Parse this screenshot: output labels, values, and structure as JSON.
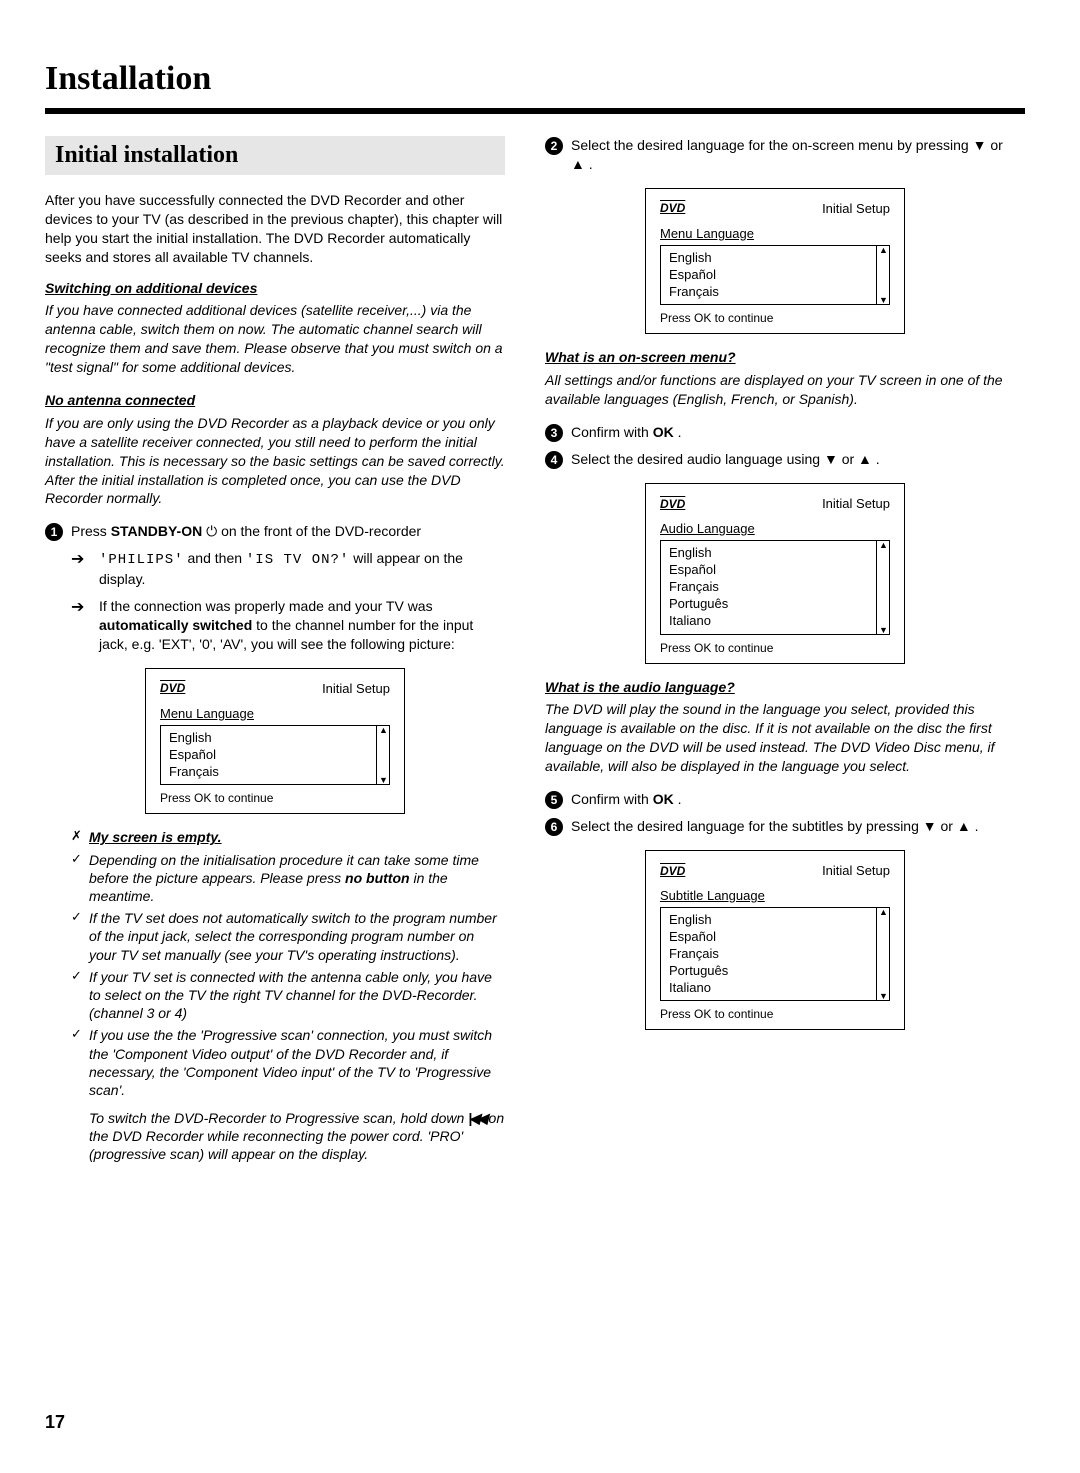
{
  "title": "Installation",
  "section": "Initial installation",
  "intro": "After you have successfully connected the DVD Recorder and other devices to your TV (as described in the previous chapter), this chapter will help you start the initial installation. The DVD Recorder automatically seeks and stores all available TV channels.",
  "sub1_title": "Switching on additional devices",
  "sub1_body": "If you have connected additional devices (satellite receiver,...) via the antenna cable, switch them on now. The automatic channel search will recognize them and save them. Please observe that you must switch on a \"test signal\" for some additional devices.",
  "sub2_title": "No antenna connected",
  "sub2_body": "If you are only using the DVD Recorder as a playback device or you only have a satellite receiver connected, you still need to perform the initial installation. This is necessary so the basic settings can be saved correctly. After the initial installation is completed once, you can use the DVD Recorder normally.",
  "step1_pre": "Press ",
  "step1_bold": "STANDBY-ON",
  "step1_post": " on the front of the DVD-recorder",
  "step1_sub_a": "'PHILIPS'",
  "step1_sub_mid": " and then ",
  "step1_sub_b": "'IS TV ON?'",
  "step1_sub_end": " will appear on the display.",
  "step1_sub2_pre": "If the connection was properly made and your TV was ",
  "step1_sub2_bold": "automatically switched",
  "step1_sub2_post": " to the channel number for the input jack, e.g. 'EXT', '0', 'AV', you will see the following picture:",
  "tv": {
    "logo": "DVD",
    "setup": "Initial Setup",
    "menu_lang": "Menu Language",
    "audio_lang": "Audio Language",
    "sub_lang": "Subtitle Language",
    "ok": "Press OK to continue",
    "langs3": [
      "English",
      "Español",
      "Français"
    ],
    "langs5": [
      "English",
      "Español",
      "Français",
      "Português",
      "Italiano"
    ]
  },
  "trouble_title": "My screen is empty.",
  "trouble": [
    "Depending on the initialisation procedure it can take some time before the picture appears. Please press no button in the meantime.",
    "If the TV set does not automatically switch to the program number of the input jack, select the corresponding program number on your TV set manually (see your TV's operating instructions).",
    "If your TV set is connected with the antenna cable only, you have to select on the TV the right TV channel for the DVD-Recorder. (channel 3 or 4)",
    "If you use the the 'Progressive scan' connection, you must switch the 'Component Video output' of the DVD Recorder and, if necessary, the 'Component Video input' of the TV to 'Progressive scan'."
  ],
  "trouble_foot": "To switch the DVD-Recorder to Progressive scan, hold down  |◀◀  on the DVD Recorder while reconnecting the power cord. 'PRO' (progressive scan) will appear on the display.",
  "step2": "Select the desired language for the on-screen menu by pressing ▼ or ▲ .",
  "osm_title": "What is an on-screen menu?",
  "osm_body": "All settings and/or functions are displayed on your TV screen in one of the available languages (English, French, or Spanish).",
  "step3": "Confirm with  OK .",
  "step4": "Select the desired audio language using ▼ or ▲ .",
  "audio_title": "What is the audio language?",
  "audio_body": "The DVD will play the sound in the language you select, provided this language is available on the disc. If it is not available on the disc the first language on the DVD will be used instead. The DVD Video Disc menu, if available, will also be displayed in the language you select.",
  "step5": "Confirm with  OK .",
  "step6": "Select the desired language for the subtitles by pressing ▼ or ▲ .",
  "pagenum": "17"
}
